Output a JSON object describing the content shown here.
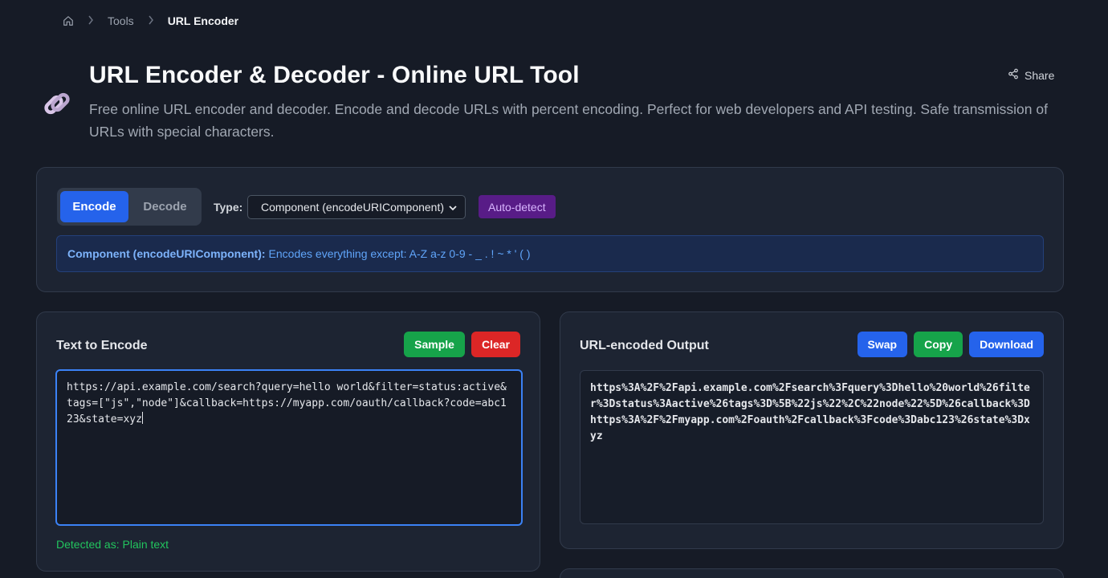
{
  "breadcrumb": {
    "home_icon": "home-icon",
    "items": [
      "Tools",
      "URL Encoder"
    ]
  },
  "header": {
    "icon": "link-icon",
    "title": "URL Encoder & Decoder - Online URL Tool",
    "subtitle": "Free online URL encoder and decoder. Encode and decode URLs with percent encoding. Perfect for web developers and API testing. Safe transmission of URLs with special characters.",
    "share_label": "Share"
  },
  "options": {
    "mode_encode": "Encode",
    "mode_decode": "Decode",
    "active_mode": "Encode",
    "type_label": "Type:",
    "type_value": "Component (encodeURIComponent)",
    "autodetect_label": "Auto-detect",
    "info_title": "Component (encodeURIComponent):",
    "info_text": "Encodes everything except: A-Z a-z 0-9 - _ . ! ~ * ' ( )"
  },
  "input": {
    "title": "Text to Encode",
    "sample_label": "Sample",
    "clear_label": "Clear",
    "value": "https://api.example.com/search?query=hello world&filter=status:active&tags=[\"js\",\"node\"]&callback=https://myapp.com/oauth/callback?code=abc123&state=xyz",
    "detected": "Detected as: Plain text"
  },
  "output": {
    "title": "URL-encoded Output",
    "swap_label": "Swap",
    "copy_label": "Copy",
    "download_label": "Download",
    "value": "https%3A%2F%2Fapi.example.com%2Fsearch%3Fquery%3Dhello%20world%26filter%3Dstatus%3Aactive%26tags%3D%5B%22js%22%2C%22node%22%5D%26callback%3Dhttps%3A%2F%2Fmyapp.com%2Foauth%2Fcallback%3Fcode%3Dabc123%26state%3Dxyz"
  },
  "colors": {
    "background": "#161b26",
    "card": "#1d2432",
    "accent_blue": "#2563eb",
    "success_green": "#16a34a",
    "danger_red": "#dc2626",
    "purple_badge": "#581c87"
  }
}
